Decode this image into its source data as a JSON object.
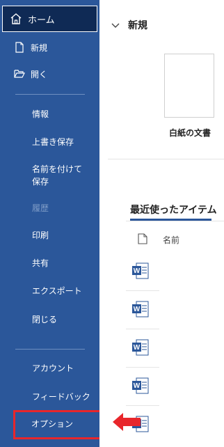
{
  "sidebar": {
    "home": {
      "label": "ホーム",
      "icon": "home-icon"
    },
    "new": {
      "label": "新規",
      "icon": "new-document-icon"
    },
    "open": {
      "label": "開く",
      "icon": "open-folder-icon"
    },
    "info": {
      "label": "情報"
    },
    "save": {
      "label": "上書き保存"
    },
    "save_as": {
      "label": "名前を付けて保存"
    },
    "history": {
      "label": "履歴",
      "disabled": true
    },
    "print": {
      "label": "印刷"
    },
    "share": {
      "label": "共有"
    },
    "export": {
      "label": "エクスポート"
    },
    "close": {
      "label": "閉じる"
    },
    "account": {
      "label": "アカウント"
    },
    "feedback": {
      "label": "フィードバック"
    },
    "options": {
      "label": "オプション"
    }
  },
  "main": {
    "new_section": {
      "title": "新規"
    },
    "blank_template": {
      "label": "白紙の文書"
    },
    "recent": {
      "title": "最近使ったアイテム",
      "column_name": "名前"
    }
  },
  "colors": {
    "sidebar_bg": "#2b579a",
    "home_selected_bg": "#0f2a55",
    "highlight": "#e8262b"
  }
}
